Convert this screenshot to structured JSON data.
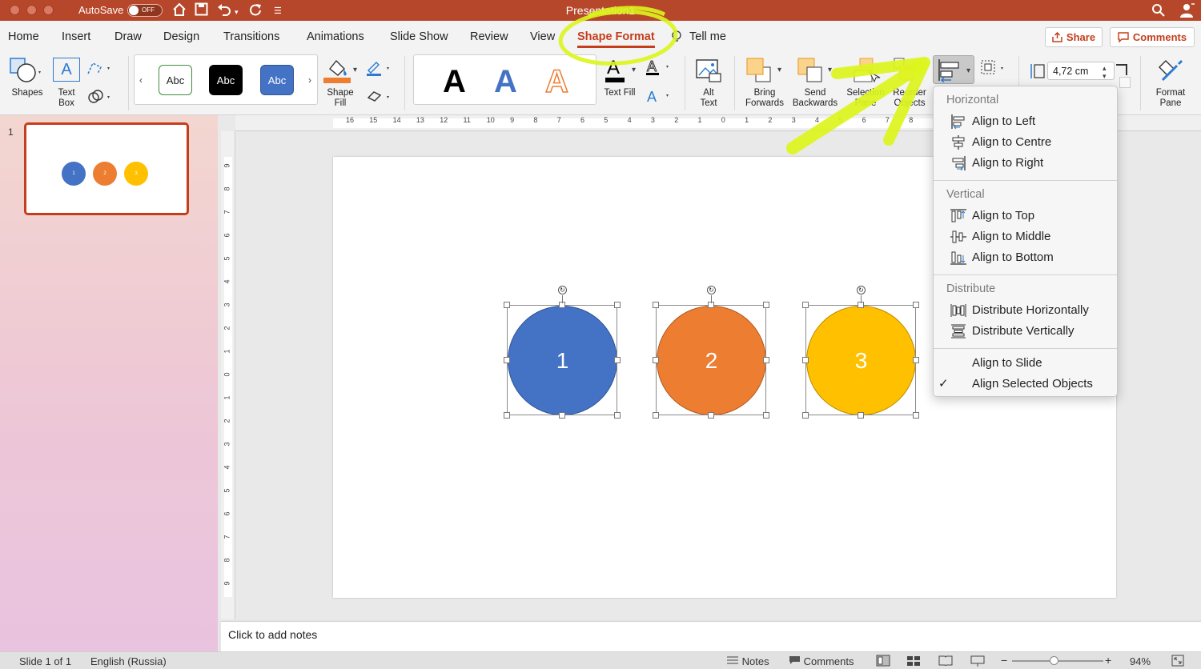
{
  "titlebar": {
    "autosave_label": "AutoSave",
    "toggle_state": "OFF",
    "document_title": "Presentation1"
  },
  "tabs": [
    {
      "label": "Home"
    },
    {
      "label": "Insert"
    },
    {
      "label": "Draw"
    },
    {
      "label": "Design"
    },
    {
      "label": "Transitions"
    },
    {
      "label": "Animations"
    },
    {
      "label": "Slide Show"
    },
    {
      "label": "Review"
    },
    {
      "label": "View"
    },
    {
      "label": "Shape Format"
    },
    {
      "label": "Tell me"
    }
  ],
  "active_tab": "Shape Format",
  "share_label": "Share",
  "comments_label": "Comments",
  "ribbon": {
    "shapes": "Shapes",
    "text_box_line1": "Text",
    "text_box_line2": "Box",
    "style_samples": [
      "Abc",
      "Abc",
      "Abc"
    ],
    "shape_fill_line1": "Shape",
    "shape_fill_line2": "Fill",
    "wordart_letter": "A",
    "text_fill": "Text Fill",
    "alt_text_line1": "Alt",
    "alt_text_line2": "Text",
    "bring_forwards_line1": "Bring",
    "bring_forwards_line2": "Forwards",
    "send_backwards_line1": "Send",
    "send_backwards_line2": "Backwards",
    "selection_pane_line1": "Selection",
    "selection_pane_line2": "Pane",
    "reorder_line1": "Reorder",
    "reorder_line2": "Objects",
    "height_value": "4,72 cm",
    "format_pane_line1": "Format",
    "format_pane_line2": "Pane"
  },
  "thumbnail": {
    "slide_number": "1",
    "labels": [
      "1",
      "2",
      "3"
    ]
  },
  "slide": {
    "shapes": [
      {
        "label": "1",
        "color": "#4472c4"
      },
      {
        "label": "2",
        "color": "#ed7d31"
      },
      {
        "label": "3",
        "color": "#ffc000"
      }
    ]
  },
  "ruler": {
    "h_ticks": [
      "16",
      "15",
      "14",
      "13",
      "12",
      "11",
      "10",
      "9",
      "8",
      "7",
      "6",
      "5",
      "4",
      "3",
      "2",
      "1",
      "0",
      "1",
      "2",
      "3",
      "4",
      "5",
      "6",
      "7",
      "8"
    ],
    "v_ticks": [
      "9",
      "8",
      "7",
      "6",
      "5",
      "4",
      "3",
      "2",
      "1",
      "0",
      "1",
      "2",
      "3",
      "4",
      "5",
      "6",
      "7",
      "8",
      "9"
    ]
  },
  "notes_placeholder": "Click to add notes",
  "status": {
    "slide_info": "Slide 1 of 1",
    "language": "English (Russia)",
    "notes": "Notes",
    "comments": "Comments",
    "zoom": "94%"
  },
  "align_menu": {
    "horizontal_header": "Horizontal",
    "align_left": "Align to Left",
    "align_centre": "Align to Centre",
    "align_right": "Align to Right",
    "vertical_header": "Vertical",
    "align_top": "Align to Top",
    "align_middle": "Align to Middle",
    "align_bottom": "Align to Bottom",
    "distribute_header": "Distribute",
    "distribute_h": "Distribute Horizontally",
    "distribute_v": "Distribute Vertically",
    "align_slide": "Align to Slide",
    "align_selected": "Align Selected Objects",
    "checked_item": "Align Selected Objects"
  },
  "colors": {
    "accent": "#c43e1c",
    "titlebar": "#b7472a",
    "highlight": "#dcf51c"
  }
}
